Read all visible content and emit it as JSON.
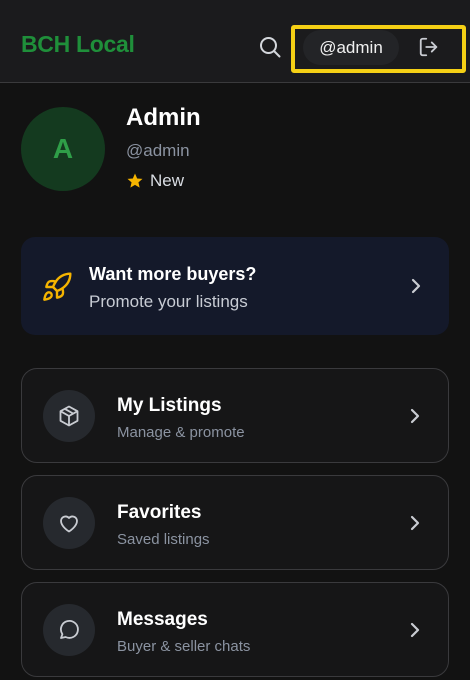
{
  "header": {
    "brand": "BCH Local",
    "search_icon": "search-icon",
    "username": "@admin",
    "logout_icon": "logout-icon"
  },
  "profile": {
    "avatar_initial": "A",
    "name": "Admin",
    "handle": "@admin",
    "badge": "New",
    "badge_icon": "star-icon"
  },
  "promo": {
    "icon": "rocket-icon",
    "title": "Want more buyers?",
    "subtitle": "Promote your listings"
  },
  "menu": [
    {
      "icon": "box-icon",
      "title": "My Listings",
      "subtitle": "Manage & promote"
    },
    {
      "icon": "heart-icon",
      "title": "Favorites",
      "subtitle": "Saved listings"
    },
    {
      "icon": "chat-icon",
      "title": "Messages",
      "subtitle": "Buyer & seller chats"
    }
  ],
  "colors": {
    "brand": "#1f8f3a",
    "highlight": "#f5d015",
    "star": "#f5b400",
    "promo_bg": "#14192a"
  }
}
